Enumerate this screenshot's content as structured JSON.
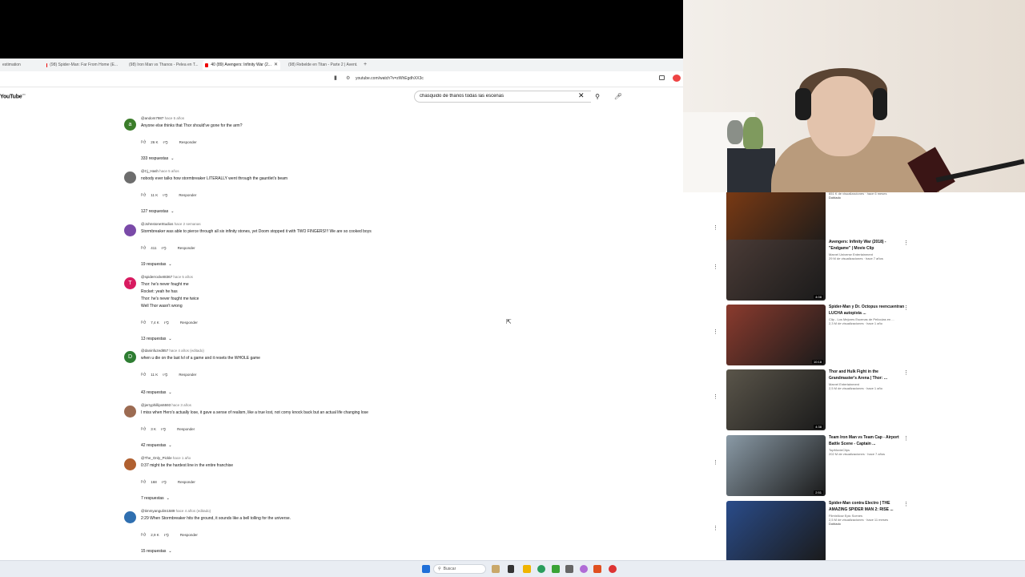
{
  "tabs": [
    {
      "label": "estimation"
    },
    {
      "label": "(98) Spider-Man: Far From Home (E..."
    },
    {
      "label": "(98) Iron Man vs Thanos - Pelea en T..."
    },
    {
      "label": "40 (89) Avengers: Infinity War (2..."
    },
    {
      "label": "(98) Rebelde en Titan - Parte 2 | Avent..."
    }
  ],
  "url": "youtube.com/watch?v=zWhEgdhXX3c",
  "youtube_logo": "YouTube",
  "youtube_logo_region": "MX",
  "search": {
    "value": "chasquido de thanos todas las escenas"
  },
  "comments": [
    {
      "handle": "@andom7987",
      "ago": "hace 5 años",
      "text": "Anyone else thinks that Thor should've gone for the arm?",
      "likes": "26 K",
      "reply_label": "Responder",
      "replies": "333 respuestas",
      "avatar_letter": "a",
      "avatar_color": "#3b7d2a"
    },
    {
      "handle": "@Cj_Hash",
      "ago": "hace 5 años",
      "text": "nobody ever talks how stormbreaker LITERALLY went through the gauntlet's beam",
      "likes": "11 K",
      "reply_label": "Responder",
      "replies": "127 respuestas",
      "avatar_letter": "",
      "avatar_color": "#6d6d6d"
    },
    {
      "handle": "@JohnstoneStudios",
      "ago": "hace 2 semanas",
      "text": "Stormbreaker was able to pierce through all six infinity stones, yet Doom stopped it with TWO FINGERS!!! We are so cooked boys",
      "likes": "411",
      "reply_label": "Responder",
      "replies": "19 respuestas",
      "avatar_letter": "",
      "avatar_color": "#7a4aa8"
    },
    {
      "handle": "@spiderrocket8367",
      "ago": "hace 5 años",
      "text": "Thor: he's never fought me\nRocket: yeah he has\nThor: he's never fought me twice\nWell Thor wasn't wrong",
      "likes": "7,4 K",
      "reply_label": "Responder",
      "replies": "13 respuestas",
      "avatar_letter": "T",
      "avatar_color": "#d81b60"
    },
    {
      "handle": "@daninfuzed857",
      "ago": "hace 4 años (editado)",
      "text": "when u die on the last lvl of a game and it resets the WHOLE game",
      "likes": "11 K",
      "reply_label": "Responder",
      "replies": "43 respuestas",
      "avatar_letter": "D",
      "avatar_color": "#2e7d32"
    },
    {
      "handle": "@jerryphillips6593",
      "ago": "hace 3 años",
      "text": "I miss when Hero's actually lose, it gave a sense of realism, like a true lost, not corny knock back but an actual life changing lose",
      "likes": "3 K",
      "reply_label": "Responder",
      "replies": "42 respuestas",
      "avatar_letter": "",
      "avatar_color": "#9c6b52"
    },
    {
      "handle": "@The_Only_Pickle",
      "ago": "hace 1 año",
      "text": "0:37 might be the hardest line in the entire franchise",
      "likes": "168",
      "reply_label": "Responder",
      "replies": "7 respuestas",
      "avatar_letter": "",
      "avatar_color": "#b06030"
    },
    {
      "handle": "@timmyangulim1589",
      "ago": "hace 4 años (editado)",
      "text": "2:29 When Stormbreaker hits the ground, it sounds like a bell tolling for the universe.",
      "likes": "2,9 K",
      "reply_label": "Responder",
      "replies": "15 respuestas",
      "avatar_letter": "",
      "avatar_color": "#2f6fb0"
    }
  ],
  "videos": [
    {
      "title": "",
      "channel": "",
      "stats": "651 K de visualizaciones · hace 6 meses",
      "badge": "Doblado",
      "duration": "8:49",
      "thumb": "#7a3a14"
    },
    {
      "title": "Avengers: Infinity War (2018) - \"Endgame\" | Movie Clip",
      "channel": "Marvel Universe Entertainment",
      "stats": "29 M de visualizaciones · hace 7 años",
      "badge": "",
      "duration": "4:08",
      "thumb": "#4a3b36"
    },
    {
      "title": "Spider-Man y Dr. Octopus reencuentran LUCHA autopista ...",
      "channel": "Clip - Los Mejores Escenas de Películas en ...",
      "stats": "2,3 M de visualizaciones · hace 1 año",
      "badge": "",
      "duration": "10:18",
      "thumb": "#8b3b2e"
    },
    {
      "title": "Thor and Hulk Fight in the Grandmaster's Arena | Thor: ...",
      "channel": "Marvel Entertainment",
      "stats": "2,5 M de visualizaciones · hace 1 año",
      "badge": "",
      "duration": "4:38",
      "thumb": "#5a554a"
    },
    {
      "title": "Team Iron Man vs Team Cap - Airport Battle Scene - Captain ...",
      "channel": "TopMovieClips",
      "stats": "202 M de visualizaciones · hace 7 años",
      "badge": "",
      "duration": "2:51",
      "thumb": "#8a9aa6"
    },
    {
      "title": "Spider-Man contra Electro | THE AMAZING SPIDER MAN 2: RISE ...",
      "channel": "FilmIsNow Epic Scenes",
      "stats": "2,5 M de visualizaciones · hace 11 meses",
      "badge": "Doblado",
      "duration": "",
      "thumb": "#2a4c8a"
    }
  ],
  "taskbar": {
    "search_placeholder": "Buscar"
  }
}
